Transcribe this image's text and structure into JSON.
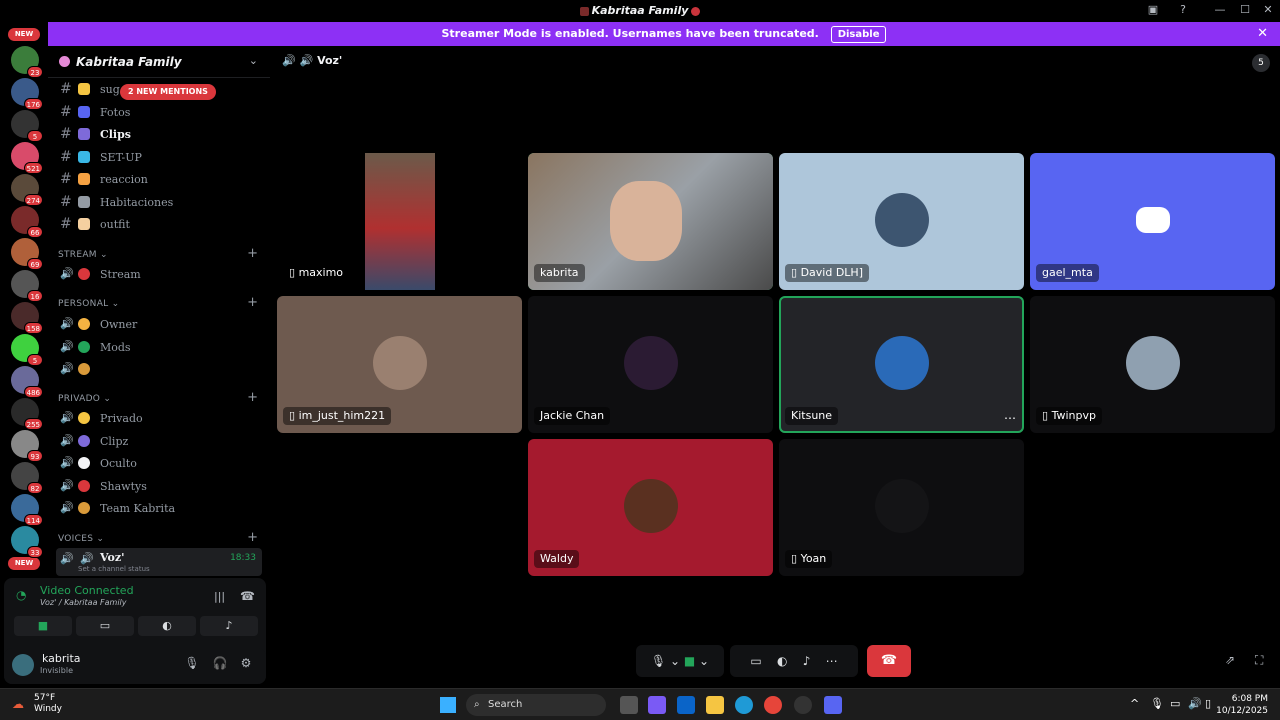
{
  "window": {
    "title": "Kabritaa Family"
  },
  "streamer_banner": {
    "text": "Streamer Mode is enabled. Usernames have been truncated.",
    "button": "Disable"
  },
  "servers": [
    {
      "badge": "23",
      "color": "#3b7d3b"
    },
    {
      "badge": "176",
      "color": "#3a5a8a"
    },
    {
      "badge": "5",
      "color": "#333"
    },
    {
      "badge": "521",
      "color": "#d94b6a"
    },
    {
      "badge": "274",
      "color": "#5a4a3a"
    },
    {
      "badge": "66",
      "color": "#7a2a2a"
    },
    {
      "badge": "69",
      "color": "#b0603a"
    },
    {
      "badge": "16",
      "color": "#555"
    },
    {
      "badge": "158",
      "color": "#4a2a2a"
    },
    {
      "badge": "5",
      "color": "#3fd13f"
    },
    {
      "badge": "486",
      "color": "#6a6a9a"
    },
    {
      "badge": "255",
      "color": "#2a2a2a"
    },
    {
      "badge": "93",
      "color": "#888"
    },
    {
      "badge": "82",
      "color": "#444"
    },
    {
      "badge": "114",
      "color": "#3a6a9a"
    },
    {
      "badge": "33",
      "color": "#2a8aa0"
    }
  ],
  "new_label": "NEW",
  "guild": {
    "name": "Kabritaa Family"
  },
  "mentions_pill": "2 NEW MENTIONS",
  "text_channels": [
    {
      "name": "sug",
      "emoji_color": "#f5c542"
    },
    {
      "name": "Fotos",
      "emoji_color": "#5865f2"
    },
    {
      "name": "Clips",
      "emoji_color": "#7e6ad9",
      "active": true
    },
    {
      "name": "SET-UP",
      "emoji_color": "#3ab8e6"
    },
    {
      "name": "reaccion",
      "emoji_color": "#f5a142"
    },
    {
      "name": "Habitaciones",
      "emoji_color": "#949ba4"
    },
    {
      "name": "outfit",
      "emoji_color": "#f5d0a0"
    }
  ],
  "categories": {
    "stream": "STREAM",
    "personal": "PERSONAL",
    "privado": "PRIVADO",
    "voices": "VOICES"
  },
  "voice_channels": {
    "stream": [
      {
        "name": "Stream",
        "emoji_color": "#da373c"
      }
    ],
    "personal": [
      {
        "name": "Owner",
        "emoji_color": "#f5b342"
      },
      {
        "name": "Mods",
        "emoji_color": "#23a55a"
      },
      {
        "name": "",
        "emoji_color": "#d99a3a"
      }
    ],
    "privado": [
      {
        "name": "Privado",
        "emoji_color": "#f5c542"
      },
      {
        "name": "Clipz",
        "emoji_color": "#7e6ad9"
      },
      {
        "name": "Oculto",
        "emoji_color": "#f2f3f5"
      },
      {
        "name": "Shawtys",
        "emoji_color": "#da373c"
      },
      {
        "name": "Team Kabrita",
        "emoji_color": "#d99a3a"
      }
    ]
  },
  "current_voice": {
    "name": "Voz'",
    "time": "18:33",
    "status_placeholder": "Set a channel status"
  },
  "voice_panel": {
    "status": "Video Connected",
    "location": "Voz' / Kabritaa Family"
  },
  "user": {
    "name": "kabrita",
    "status": "Invisible"
  },
  "voice_header": {
    "title": "Voz'"
  },
  "participants": [
    {
      "name": "maximo",
      "bg": "#000000",
      "kind": "video",
      "mobile": true
    },
    {
      "name": "kabrita",
      "bg": "#6b6f72",
      "kind": "video",
      "speaking": true
    },
    {
      "name": "David DLH]",
      "bg": "#aec6da",
      "kind": "avatar",
      "avatar_color": "#3d5570",
      "mobile": true
    },
    {
      "name": "gael_mta",
      "bg": "#5865f2",
      "kind": "discord"
    },
    {
      "name": "im_just_him221",
      "bg": "#6e5a4f",
      "kind": "avatar",
      "avatar_color": "#9a8070",
      "mobile": true
    },
    {
      "name": "Jackie Chan",
      "bg": "#0e0e10",
      "kind": "avatar",
      "avatar_color": "#2b1b33"
    },
    {
      "name": "Kitsune",
      "bg": "#232428",
      "kind": "avatar",
      "avatar_color": "#2a6ab8",
      "speaking": true
    },
    {
      "name": "Twinpvp",
      "bg": "#0e0e10",
      "kind": "avatar",
      "avatar_color": "#8fa0b0",
      "mobile": true
    },
    {
      "name": "Waldy",
      "bg": "#a51a2e",
      "kind": "avatar",
      "avatar_color": "#5a3020"
    },
    {
      "name": "Yoan",
      "bg": "#0e0e10",
      "kind": "avatar",
      "avatar_color": "#141416",
      "mobile": true
    }
  ],
  "header_badge": "5",
  "taskbar": {
    "temp": "57°F",
    "weather": "Windy",
    "search": "Search",
    "time": "6:08 PM",
    "date": "10/12/2025"
  }
}
